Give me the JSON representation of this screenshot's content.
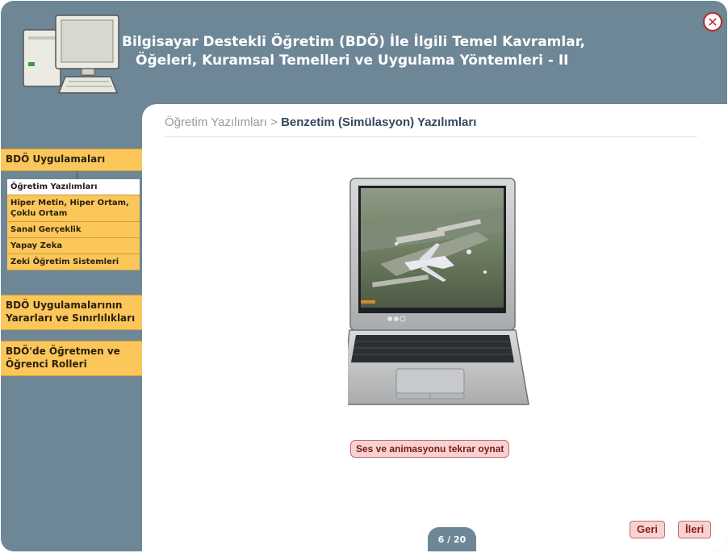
{
  "header": {
    "title_line1": "Bilgisayar Destekli Öğretim (BDÖ) İle İlgili Temel Kavramlar,",
    "title_line2": "Öğeleri, Kuramsal Temelleri ve Uygulama Yöntemleri - II",
    "close_label": "✕"
  },
  "breadcrumb": {
    "parent": "Öğretim Yazılımları",
    "separator": " > ",
    "current": "Benzetim (Simülasyon) Yazılımları"
  },
  "sidebar": {
    "sections": [
      {
        "label": "BDÖ Uygulamaları"
      },
      {
        "label": "BDÖ Uygulamalarının Yararları ve Sınırlılıkları"
      },
      {
        "label": "BDÖ'de Öğretmen ve Öğrenci Rolleri"
      }
    ],
    "items": [
      {
        "label": "Öğretim Yazılımları",
        "active": true
      },
      {
        "label": "Hiper Metin, Hiper Ortam, Çoklu Ortam"
      },
      {
        "label": "Sanal Gerçeklik"
      },
      {
        "label": "Yapay Zeka"
      },
      {
        "label": "Zeki Öğretim Sistemleri"
      }
    ]
  },
  "main": {
    "replay_label": "Ses ve animasyonu tekrar oynat"
  },
  "footer": {
    "page_indicator": "6 / 20",
    "back_label": "Geri",
    "next_label": "İleri"
  },
  "colors": {
    "background": "#6d8797",
    "section_fill": "#fbc75a",
    "button_fill": "#f6d2d2",
    "close_red": "#c3282b"
  }
}
